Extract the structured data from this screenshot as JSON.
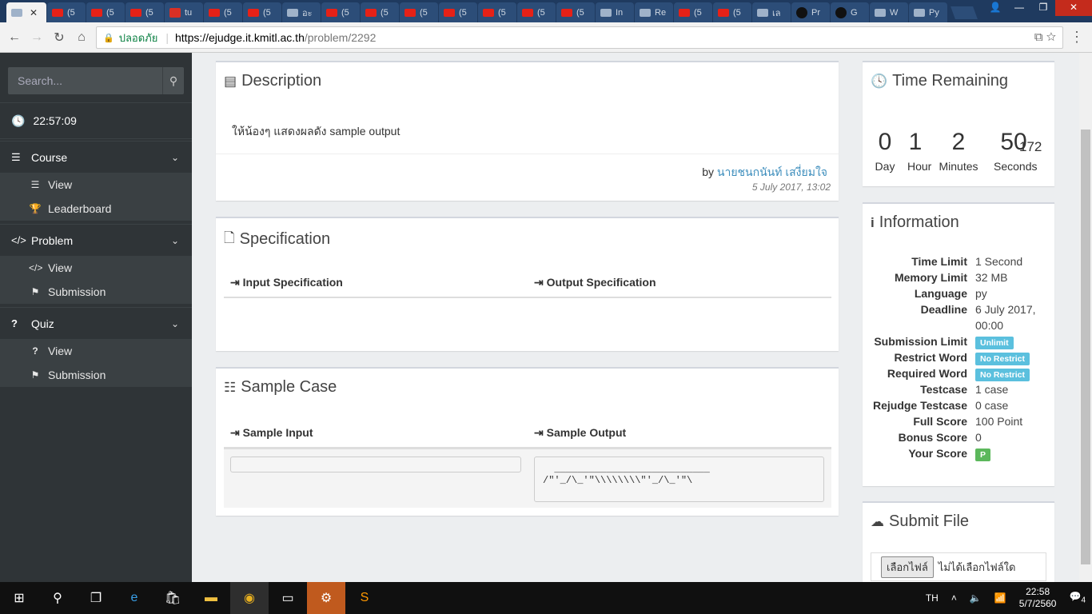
{
  "browser": {
    "tabs": [
      {
        "label": "",
        "icon": "ejudge-favicon",
        "active": true
      },
      {
        "label": "(5",
        "icon": "youtube-icon"
      },
      {
        "label": "(5",
        "icon": "youtube-icon"
      },
      {
        "label": "(5",
        "icon": "youtube-icon"
      },
      {
        "label": "tu",
        "icon": "pdf-icon"
      },
      {
        "label": "(5",
        "icon": "youtube-icon"
      },
      {
        "label": "(5",
        "icon": "youtube-icon"
      },
      {
        "label": "อะ",
        "icon": "generic-icon"
      },
      {
        "label": "(5",
        "icon": "youtube-icon"
      },
      {
        "label": "(5",
        "icon": "youtube-icon"
      },
      {
        "label": "(5",
        "icon": "youtube-icon"
      },
      {
        "label": "(5",
        "icon": "youtube-icon"
      },
      {
        "label": "(5",
        "icon": "youtube-icon"
      },
      {
        "label": "(5",
        "icon": "youtube-icon"
      },
      {
        "label": "(5",
        "icon": "youtube-icon"
      },
      {
        "label": "In",
        "icon": "generic-icon"
      },
      {
        "label": "Re",
        "icon": "generic-icon"
      },
      {
        "label": "(5",
        "icon": "youtube-icon"
      },
      {
        "label": "(5",
        "icon": "youtube-icon"
      },
      {
        "label": "เล",
        "icon": "generic-icon"
      },
      {
        "label": "Pr",
        "icon": "github-icon"
      },
      {
        "label": "G",
        "icon": "github-icon"
      },
      {
        "label": "W",
        "icon": "generic-icon"
      },
      {
        "label": "Py",
        "icon": "generic-icon"
      }
    ],
    "secure_label": "ปลอดภัย",
    "url_host": "https://ejudge.it.kmitl.ac.th",
    "url_path": "/problem/2292"
  },
  "sidebar": {
    "search_placeholder": "Search...",
    "clock": "22:57:09",
    "sections": [
      {
        "label": "Course",
        "items": [
          "View",
          "Leaderboard"
        ]
      },
      {
        "label": "Problem",
        "items": [
          "View",
          "Submission"
        ]
      },
      {
        "label": "Quiz",
        "items": [
          "View",
          "Submission"
        ]
      }
    ]
  },
  "description": {
    "title": "Description",
    "text": "ให้น้องๆ แสดงผลดัง sample output",
    "by_prefix": "by",
    "author": "นายชนกนันท์ เสงี่ยมใจ",
    "date": "5 July 2017, 13:02"
  },
  "specification": {
    "title": "Specification",
    "input_label": "Input Specification",
    "output_label": "Output Specification"
  },
  "sample": {
    "title": "Sample Case",
    "input_label": "Sample Input",
    "output_label": "Sample Output",
    "output_text": "  ___________________________\n/\"'_/\\_'\"\\\\\\\\\\\\\\\\\"'_/\\_'\"\\"
  },
  "time_remaining": {
    "title": "Time Remaining",
    "day": "0",
    "hour": "1",
    "minutes": "2",
    "seconds": "50",
    "ms": "172",
    "day_label": "Day",
    "hour_label": "Hour",
    "minutes_label": "Minutes",
    "seconds_label": "Seconds"
  },
  "information": {
    "title": "Information",
    "rows": [
      {
        "key": "Time Limit",
        "value": "1 Second"
      },
      {
        "key": "Memory Limit",
        "value": "32 MB"
      },
      {
        "key": "Language",
        "value": "py"
      },
      {
        "key": "Deadline",
        "value": "6 July 2017,"
      },
      {
        "key": "",
        "value": "00:00"
      },
      {
        "key": "Submission Limit",
        "badge": "Unlimit"
      },
      {
        "key": "Restrict Word",
        "badge": "No Restrict"
      },
      {
        "key": "Required Word",
        "badge": "No Restrict"
      },
      {
        "key": "Testcase",
        "value": "1 case"
      },
      {
        "key": "Rejudge Testcase",
        "value": "0 case"
      },
      {
        "key": "Full Score",
        "value": "100 Point"
      },
      {
        "key": "Bonus Score",
        "value": "0"
      },
      {
        "key": "Your Score",
        "badge_green": "P"
      }
    ]
  },
  "submit": {
    "title": "Submit File",
    "choose_file": "เลือกไฟล์",
    "no_file": "ไม่ได้เลือกไฟล์ใด"
  },
  "taskbar": {
    "lang": "TH",
    "time": "22:58",
    "date": "5/7/2560",
    "notifications": "4"
  }
}
